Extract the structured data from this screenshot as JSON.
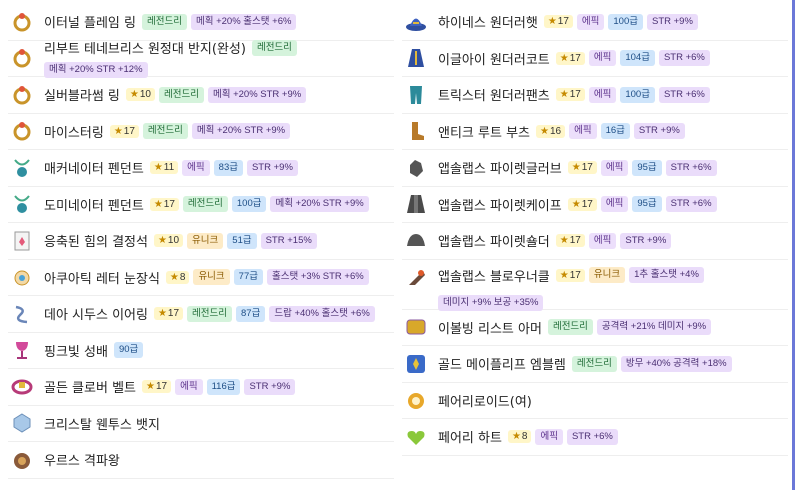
{
  "left_items": [
    {
      "name": "이터널 플레임 링",
      "icon": "ring-icon",
      "star": null,
      "grade": "레전드리",
      "grade_cls": "g-legend",
      "level": null,
      "opts": [
        "메획 +20% 홀스탯 +6%"
      ]
    },
    {
      "name": "리부트 테네브리스 원정대 반지(완성)",
      "icon": "ring-icon",
      "star": null,
      "grade": "레전드리",
      "grade_cls": "g-legend",
      "level": null,
      "opts": [
        "메획 +20% STR +12%"
      ]
    },
    {
      "name": "실버블라썸 링",
      "icon": "ring-icon",
      "star": "10",
      "grade": "레전드리",
      "grade_cls": "g-legend",
      "level": null,
      "opts": [
        "메획 +20% STR +9%"
      ]
    },
    {
      "name": "마이스터링",
      "icon": "ring-icon",
      "star": "17",
      "grade": "레전드리",
      "grade_cls": "g-legend",
      "level": null,
      "opts": [
        "메획 +20% STR +9%"
      ]
    },
    {
      "name": "매커네이터 펜던트",
      "icon": "pendant-icon",
      "star": "11",
      "grade": "에픽",
      "grade_cls": "g-epic",
      "level": "83급",
      "opts": [
        "STR +9%"
      ]
    },
    {
      "name": "도미네이터 펜던트",
      "icon": "pendant-icon",
      "star": "17",
      "grade": "레전드리",
      "grade_cls": "g-legend",
      "level": "100급",
      "opts": [
        "메획 +20% STR +9%"
      ]
    },
    {
      "name": "응축된 힘의 결정석",
      "icon": "crystal-icon",
      "star": "10",
      "grade": "유니크",
      "grade_cls": "g-unique",
      "level": "51급",
      "opts": [
        "STR +15%"
      ]
    },
    {
      "name": "아쿠아틱 레터 눈장식",
      "icon": "eye-accessory-icon",
      "star": "8",
      "grade": "유니크",
      "grade_cls": "g-unique",
      "level": "77급",
      "opts": [
        "홀스탯 +3% STR +6%"
      ]
    },
    {
      "name": "데아 시두스 이어링",
      "icon": "earring-icon",
      "star": "17",
      "grade": "레전드리",
      "grade_cls": "g-legend",
      "level": "87급",
      "opts": [
        "드랍 +40% 홀스탯 +6%"
      ]
    },
    {
      "name": "핑크빛 성배",
      "icon": "chalice-icon",
      "star": null,
      "grade": null,
      "grade_cls": "",
      "level": "90급",
      "opts": []
    },
    {
      "name": "골든 클로버 벨트",
      "icon": "belt-icon",
      "star": "17",
      "grade": "에픽",
      "grade_cls": "g-epic",
      "level": "116급",
      "opts": [
        "STR +9%"
      ]
    },
    {
      "name": "크리스탈 웬투스 뱃지",
      "icon": "badge-icon",
      "star": null,
      "grade": null,
      "grade_cls": "",
      "level": null,
      "opts": []
    },
    {
      "name": "우르스 격파왕",
      "icon": "medal-icon",
      "star": null,
      "grade": null,
      "grade_cls": "",
      "level": null,
      "opts": []
    }
  ],
  "right_items": [
    {
      "name": "하이네스 원더러햇",
      "icon": "hat-icon",
      "star": "17",
      "grade": "에픽",
      "grade_cls": "g-epic",
      "level": "100급",
      "opts": [
        "STR +9%"
      ]
    },
    {
      "name": "이글아이 원더러코트",
      "icon": "coat-icon",
      "star": "17",
      "grade": "에픽",
      "grade_cls": "g-epic",
      "level": "104급",
      "opts": [
        "STR +6%"
      ]
    },
    {
      "name": "트릭스터 원더러팬츠",
      "icon": "pants-icon",
      "star": "17",
      "grade": "에픽",
      "grade_cls": "g-epic",
      "level": "100급",
      "opts": [
        "STR +6%"
      ]
    },
    {
      "name": "앤티크 루트 부츠",
      "icon": "boots-icon",
      "star": "16",
      "grade": "에픽",
      "grade_cls": "g-epic",
      "level": "16급",
      "opts": [
        "STR +9%"
      ]
    },
    {
      "name": "앱솔랩스 파이렛글러브",
      "icon": "gloves-icon",
      "star": "17",
      "grade": "에픽",
      "grade_cls": "g-epic",
      "level": "95급",
      "opts": [
        "STR +6%"
      ]
    },
    {
      "name": "앱솔랩스 파이렛케이프",
      "icon": "cape-icon",
      "star": "17",
      "grade": "에픽",
      "grade_cls": "g-epic",
      "level": "95급",
      "opts": [
        "STR +6%"
      ]
    },
    {
      "name": "앱솔랩스 파이렛숄더",
      "icon": "shoulder-icon",
      "star": "17",
      "grade": "에픽",
      "grade_cls": "g-epic",
      "level": null,
      "opts": [
        "STR +9%"
      ]
    },
    {
      "name": "앱솔랩스 블로우너클",
      "icon": "knuckle-icon",
      "star": "17",
      "grade": "유니크",
      "grade_cls": "g-unique",
      "level": null,
      "opts": [
        "1추 홀스탯 +4%",
        "데미지 +9% 보공 +35%"
      ],
      "tall": true
    },
    {
      "name": "이볼빙 리스트 아머",
      "icon": "wrist-armor-icon",
      "star": null,
      "grade": "레전드리",
      "grade_cls": "g-legend",
      "level": null,
      "opts": [
        "공격력 +21% 데미지 +9%"
      ]
    },
    {
      "name": "골드 메이플리프 엠블렘",
      "icon": "emblem-icon",
      "star": null,
      "grade": "레전드리",
      "grade_cls": "g-legend",
      "level": null,
      "opts": [
        "방무 +40% 공격력 +18%"
      ]
    },
    {
      "name": "페어리로이드(여)",
      "icon": "android-icon",
      "star": null,
      "grade": null,
      "grade_cls": "",
      "level": null,
      "opts": []
    },
    {
      "name": "페어리 하트",
      "icon": "heart-icon",
      "star": "8",
      "grade": "에픽",
      "grade_cls": "g-epic",
      "level": null,
      "opts": [
        "STR +6%"
      ]
    }
  ]
}
